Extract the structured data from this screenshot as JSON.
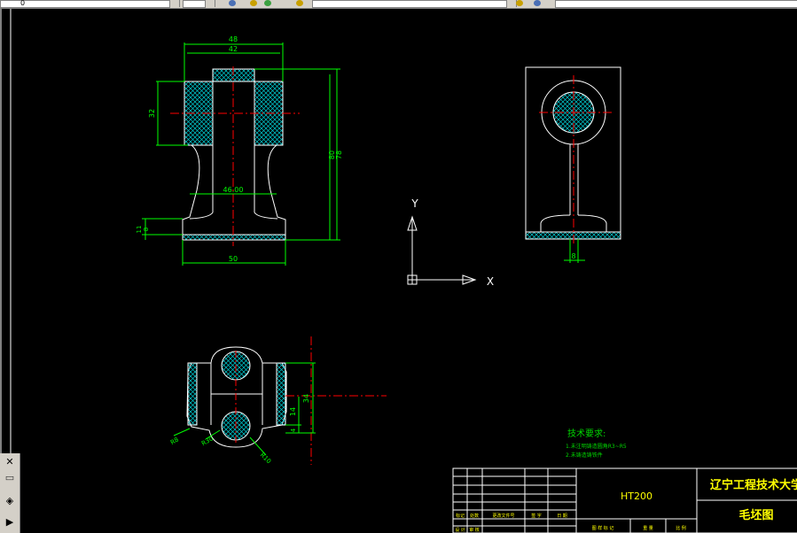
{
  "toolbar": {
    "layer_value": "0"
  },
  "sidebar": {
    "close_glyph": "✕",
    "items": [
      "▭",
      "◈",
      "▶"
    ]
  },
  "front_view": {
    "dims": {
      "top_outer": "48",
      "top_inner": "42",
      "side_height": "32",
      "height_outer": "80",
      "height_inner": "78",
      "web": "46.00",
      "base_outer": "11",
      "base_inner": "8",
      "base_width": "50"
    }
  },
  "side_view": {
    "dims": {
      "web": "8"
    }
  },
  "top_view": {
    "dims": {
      "width": "34",
      "hole_gap": "14",
      "edge": "4",
      "r_left": "R8",
      "r_mid": "R30",
      "r_right": "R10"
    }
  },
  "ucs": {
    "y_label": "Y",
    "x_label": "X"
  },
  "notes": {
    "title": "技术要求:",
    "items": [
      "1.未注明铸造圆角R3~R5",
      "2.未铸造铸铁件"
    ]
  },
  "title_block": {
    "material": "HT200",
    "school": "辽宁工程技术大学",
    "drawing_name": "毛坯图",
    "row_labels": [
      "标记",
      "处数",
      "更改文件号",
      "签 字",
      "日 期"
    ],
    "row_labels2": [
      "设 计",
      "审 核"
    ],
    "bottom_labels": [
      "图 样 标 记",
      "重 量",
      "比 例"
    ]
  },
  "colors": {
    "outline": "#ffffff",
    "dimension": "#00ff00",
    "centerline": "#ff0000",
    "hatch": "#00cfd6",
    "notes": "#00d800",
    "title_text": "#ffff00",
    "background": "#000000"
  }
}
